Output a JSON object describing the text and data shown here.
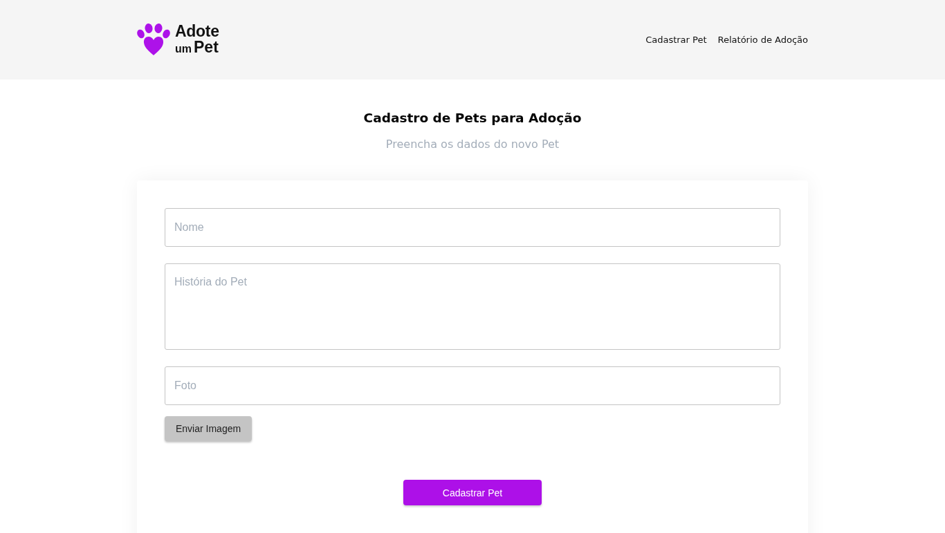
{
  "header": {
    "logo": {
      "line_1": "Adote",
      "line_2_small": "um",
      "line_2": "Pet"
    },
    "nav": [
      {
        "label": "Cadastrar Pet"
      },
      {
        "label": "Relatório de Adoção"
      }
    ]
  },
  "page": {
    "title": "Cadastro de Pets para Adoção",
    "subtitle": "Preencha os dados do novo Pet"
  },
  "form": {
    "fields": [
      {
        "kind": "input",
        "placeholder": "Nome"
      },
      {
        "kind": "textarea",
        "placeholder": "História do Pet"
      },
      {
        "kind": "input",
        "placeholder": "Foto"
      }
    ],
    "upload_button": "Enviar Imagem",
    "submit_button": "Cadastrar Pet"
  }
}
